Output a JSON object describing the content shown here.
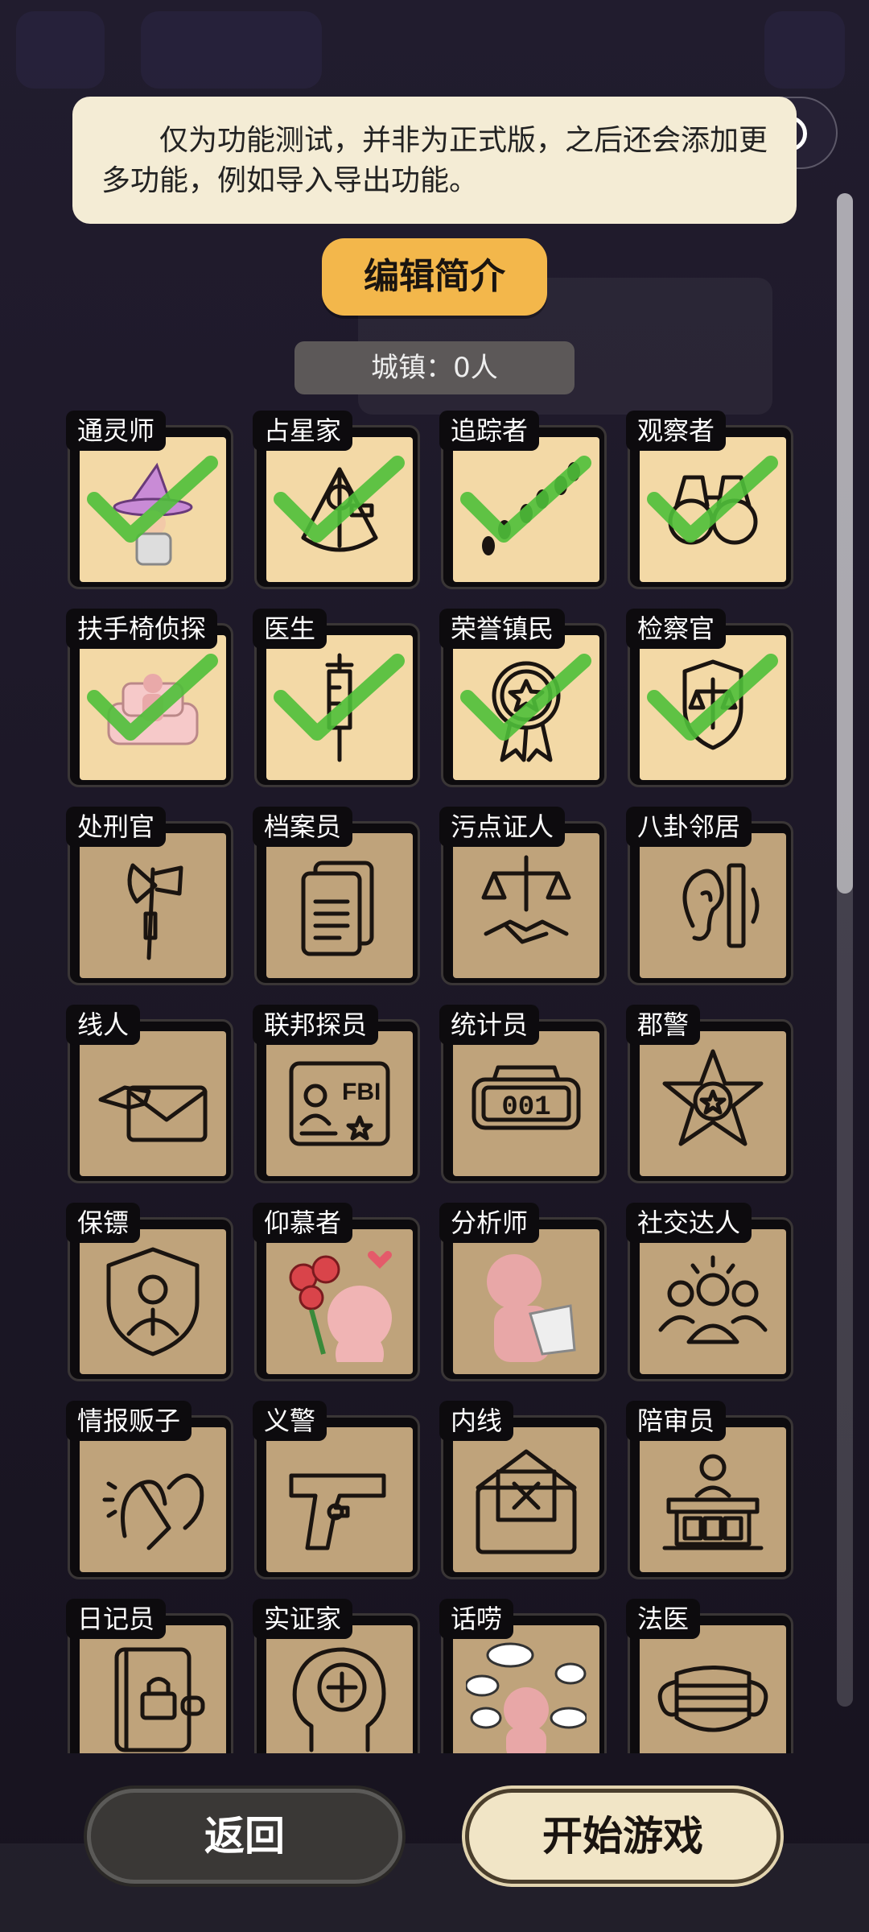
{
  "notice": {
    "text": "仅为功能测试，并非为正式版，之后还会添加更多功能，例如导入导出功能。"
  },
  "edit_button": "编辑简介",
  "town_count": "城镇：0人",
  "roles": [
    {
      "name": "通灵师",
      "icon": "witch-icon",
      "checked": true
    },
    {
      "name": "占星家",
      "icon": "sextant-icon",
      "checked": true
    },
    {
      "name": "追踪者",
      "icon": "footprints-icon",
      "checked": true
    },
    {
      "name": "观察者",
      "icon": "binoculars-icon",
      "checked": true
    },
    {
      "name": "扶手椅侦探",
      "icon": "armchair-icon",
      "checked": true
    },
    {
      "name": "医生",
      "icon": "syringe-icon",
      "checked": true
    },
    {
      "name": "荣誉镇民",
      "icon": "medal-icon",
      "checked": true
    },
    {
      "name": "检察官",
      "icon": "justice-badge-icon",
      "checked": true
    },
    {
      "name": "处刑官",
      "icon": "axe-icon",
      "checked": false
    },
    {
      "name": "档案员",
      "icon": "documents-icon",
      "checked": false
    },
    {
      "name": "污点证人",
      "icon": "scales-handshake-icon",
      "checked": false
    },
    {
      "name": "八卦邻居",
      "icon": "ear-icon",
      "checked": false
    },
    {
      "name": "线人",
      "icon": "envelope-hand-icon",
      "checked": false
    },
    {
      "name": "联邦探员",
      "icon": "fbi-card-icon",
      "checked": false
    },
    {
      "name": "统计员",
      "icon": "counter-icon",
      "checked": false
    },
    {
      "name": "郡警",
      "icon": "sheriff-star-icon",
      "checked": false
    },
    {
      "name": "保镖",
      "icon": "shield-person-icon",
      "checked": false
    },
    {
      "name": "仰慕者",
      "icon": "roses-icon",
      "checked": false
    },
    {
      "name": "分析师",
      "icon": "thinking-person-icon",
      "checked": false
    },
    {
      "name": "社交达人",
      "icon": "group-icon",
      "checked": false
    },
    {
      "name": "情报贩子",
      "icon": "whisper-icon",
      "checked": false
    },
    {
      "name": "义警",
      "icon": "pistol-icon",
      "checked": false
    },
    {
      "name": "内线",
      "icon": "envelope-x-icon",
      "checked": false
    },
    {
      "name": "陪审员",
      "icon": "jury-box-icon",
      "checked": false
    },
    {
      "name": "日记员",
      "icon": "locked-book-icon",
      "checked": false
    },
    {
      "name": "实证家",
      "icon": "head-plus-icon",
      "checked": false
    },
    {
      "name": "话唠",
      "icon": "chatter-icon",
      "checked": false
    },
    {
      "name": "法医",
      "icon": "mask-icon",
      "checked": false
    }
  ],
  "counter_digits": "001",
  "fbi_text": "FBI",
  "buttons": {
    "back": "返回",
    "start": "开始游戏"
  },
  "colors": {
    "accent": "#f3b74b",
    "card_active": "#f3d9a6",
    "card_locked": "#bfa37b",
    "check": "#4fbf3a"
  }
}
